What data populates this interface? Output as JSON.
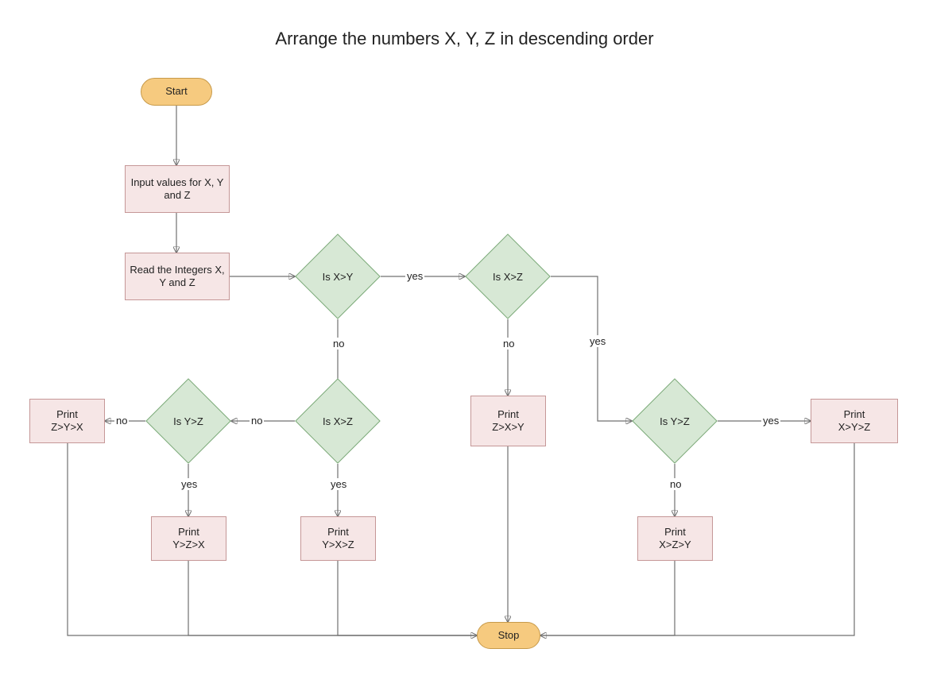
{
  "title": "Arrange the numbers X, Y, Z in descending order",
  "nodes": {
    "start": "Start",
    "input": "Input values for X, Y and Z",
    "read": "Read the Integers X, Y and Z",
    "d_xy": "Is X>Y",
    "d_xz_top": "Is X>Z",
    "d_xz_left": "Is X>Z",
    "d_yz_left": "Is Y>Z",
    "d_yz_right": "Is Y>Z",
    "p_zyx": "Print\nZ>Y>X",
    "p_yzx": "Print\nY>Z>X",
    "p_yxz": "Print\nY>X>Z",
    "p_zxy": "Print\nZ>X>Y",
    "p_xzy": "Print\nX>Z>Y",
    "p_xyz": "Print\nX>Y>Z",
    "stop": "Stop"
  },
  "edge_labels": {
    "yes": "yes",
    "no": "no"
  },
  "chart_data": {
    "type": "flowchart",
    "title": "Arrange the numbers X, Y, Z in descending order",
    "nodes": [
      {
        "id": "start",
        "type": "terminator",
        "label": "Start"
      },
      {
        "id": "input",
        "type": "process",
        "label": "Input values for X, Y and Z"
      },
      {
        "id": "read",
        "type": "process",
        "label": "Read the Integers X, Y and Z"
      },
      {
        "id": "d_xy",
        "type": "decision",
        "label": "Is X>Y"
      },
      {
        "id": "d_xz_top",
        "type": "decision",
        "label": "Is X>Z"
      },
      {
        "id": "d_xz_left",
        "type": "decision",
        "label": "Is X>Z"
      },
      {
        "id": "d_yz_left",
        "type": "decision",
        "label": "Is Y>Z"
      },
      {
        "id": "d_yz_right",
        "type": "decision",
        "label": "Is Y>Z"
      },
      {
        "id": "p_zyx",
        "type": "process",
        "label": "Print Z>Y>X"
      },
      {
        "id": "p_yzx",
        "type": "process",
        "label": "Print Y>Z>X"
      },
      {
        "id": "p_yxz",
        "type": "process",
        "label": "Print Y>X>Z"
      },
      {
        "id": "p_zxy",
        "type": "process",
        "label": "Print Z>X>Y"
      },
      {
        "id": "p_xzy",
        "type": "process",
        "label": "Print X>Z>Y"
      },
      {
        "id": "p_xyz",
        "type": "process",
        "label": "Print X>Y>Z"
      },
      {
        "id": "stop",
        "type": "terminator",
        "label": "Stop"
      }
    ],
    "edges": [
      {
        "from": "start",
        "to": "input"
      },
      {
        "from": "input",
        "to": "read"
      },
      {
        "from": "read",
        "to": "d_xy"
      },
      {
        "from": "d_xy",
        "to": "d_xz_top",
        "label": "yes"
      },
      {
        "from": "d_xy",
        "to": "d_xz_left",
        "label": "no"
      },
      {
        "from": "d_xz_top",
        "to": "d_yz_right",
        "label": "yes"
      },
      {
        "from": "d_xz_top",
        "to": "p_zxy",
        "label": "no"
      },
      {
        "from": "d_yz_right",
        "to": "p_xyz",
        "label": "yes"
      },
      {
        "from": "d_yz_right",
        "to": "p_xzy",
        "label": "no"
      },
      {
        "from": "d_xz_left",
        "to": "p_yxz",
        "label": "yes"
      },
      {
        "from": "d_xz_left",
        "to": "d_yz_left",
        "label": "no"
      },
      {
        "from": "d_yz_left",
        "to": "p_yzx",
        "label": "yes"
      },
      {
        "from": "d_yz_left",
        "to": "p_zyx",
        "label": "no"
      },
      {
        "from": "p_zyx",
        "to": "stop"
      },
      {
        "from": "p_yzx",
        "to": "stop"
      },
      {
        "from": "p_yxz",
        "to": "stop"
      },
      {
        "from": "p_zxy",
        "to": "stop"
      },
      {
        "from": "p_xzy",
        "to": "stop"
      },
      {
        "from": "p_xyz",
        "to": "stop"
      }
    ]
  }
}
